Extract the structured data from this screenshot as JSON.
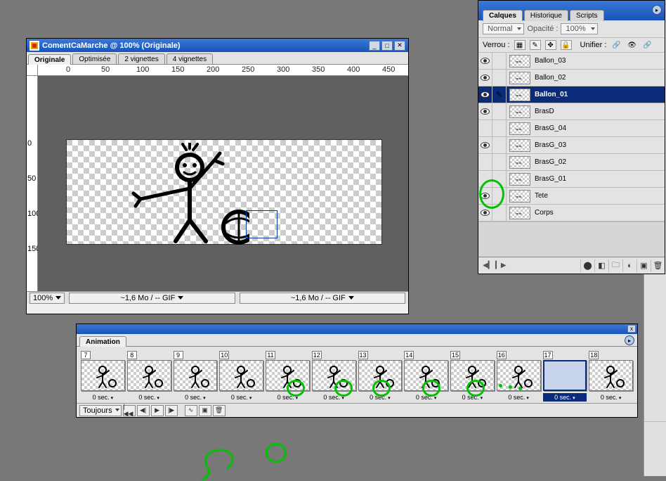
{
  "document": {
    "title": "ComentCaMarche @ 100% (Originale)",
    "tabs": [
      "Originale",
      "Optimisée",
      "2 vignettes",
      "4 vignettes"
    ],
    "active_tab": 0,
    "ruler_marks_h": [
      "0",
      "50",
      "100",
      "150",
      "200",
      "250",
      "300",
      "350",
      "400",
      "450"
    ],
    "ruler_marks_v": [
      "0",
      "50",
      "100",
      "150"
    ],
    "zoom": "100%",
    "stats": [
      "~1,6 Mo / -- GIF",
      "~1,6 Mo / -- GIF"
    ]
  },
  "layers_panel": {
    "tabs": [
      "Calques",
      "Historique",
      "Scripts"
    ],
    "active_tab": 0,
    "blend_mode": "Normal",
    "opacity_label": "Opacité :",
    "opacity_value": "100%",
    "lock_label": "Verrou :",
    "unify_label": "Unifier :",
    "layers": [
      {
        "name": "Ballon_03",
        "visible": true,
        "selected": false,
        "brush": false
      },
      {
        "name": "Ballon_02",
        "visible": true,
        "selected": false,
        "brush": false
      },
      {
        "name": "Ballon_01",
        "visible": true,
        "selected": true,
        "brush": true
      },
      {
        "name": "BrasD",
        "visible": true,
        "selected": false,
        "brush": false
      },
      {
        "name": "BrasG_04",
        "visible": false,
        "selected": false,
        "brush": false
      },
      {
        "name": "BrasG_03",
        "visible": true,
        "selected": false,
        "brush": false
      },
      {
        "name": "BrasG_02",
        "visible": false,
        "selected": false,
        "brush": false
      },
      {
        "name": "BrasG_01",
        "visible": false,
        "selected": false,
        "brush": false
      },
      {
        "name": "Tete",
        "visible": true,
        "selected": false,
        "brush": false
      },
      {
        "name": "Corps",
        "visible": true,
        "selected": false,
        "brush": false
      }
    ]
  },
  "animation_panel": {
    "title": "Animation",
    "loop": "Toujours",
    "frames": [
      {
        "n": "7",
        "t": "0 sec."
      },
      {
        "n": "8",
        "t": "0 sec."
      },
      {
        "n": "9",
        "t": "0 sec."
      },
      {
        "n": "10",
        "t": "0 sec."
      },
      {
        "n": "11",
        "t": "0 sec."
      },
      {
        "n": "12",
        "t": "0 sec."
      },
      {
        "n": "13",
        "t": "0 sec."
      },
      {
        "n": "14",
        "t": "0 sec."
      },
      {
        "n": "15",
        "t": "0 sec."
      },
      {
        "n": "16",
        "t": "0 sec."
      },
      {
        "n": "17",
        "t": "0 sec.",
        "selected": true
      },
      {
        "n": "18",
        "t": "0 sec."
      }
    ]
  }
}
